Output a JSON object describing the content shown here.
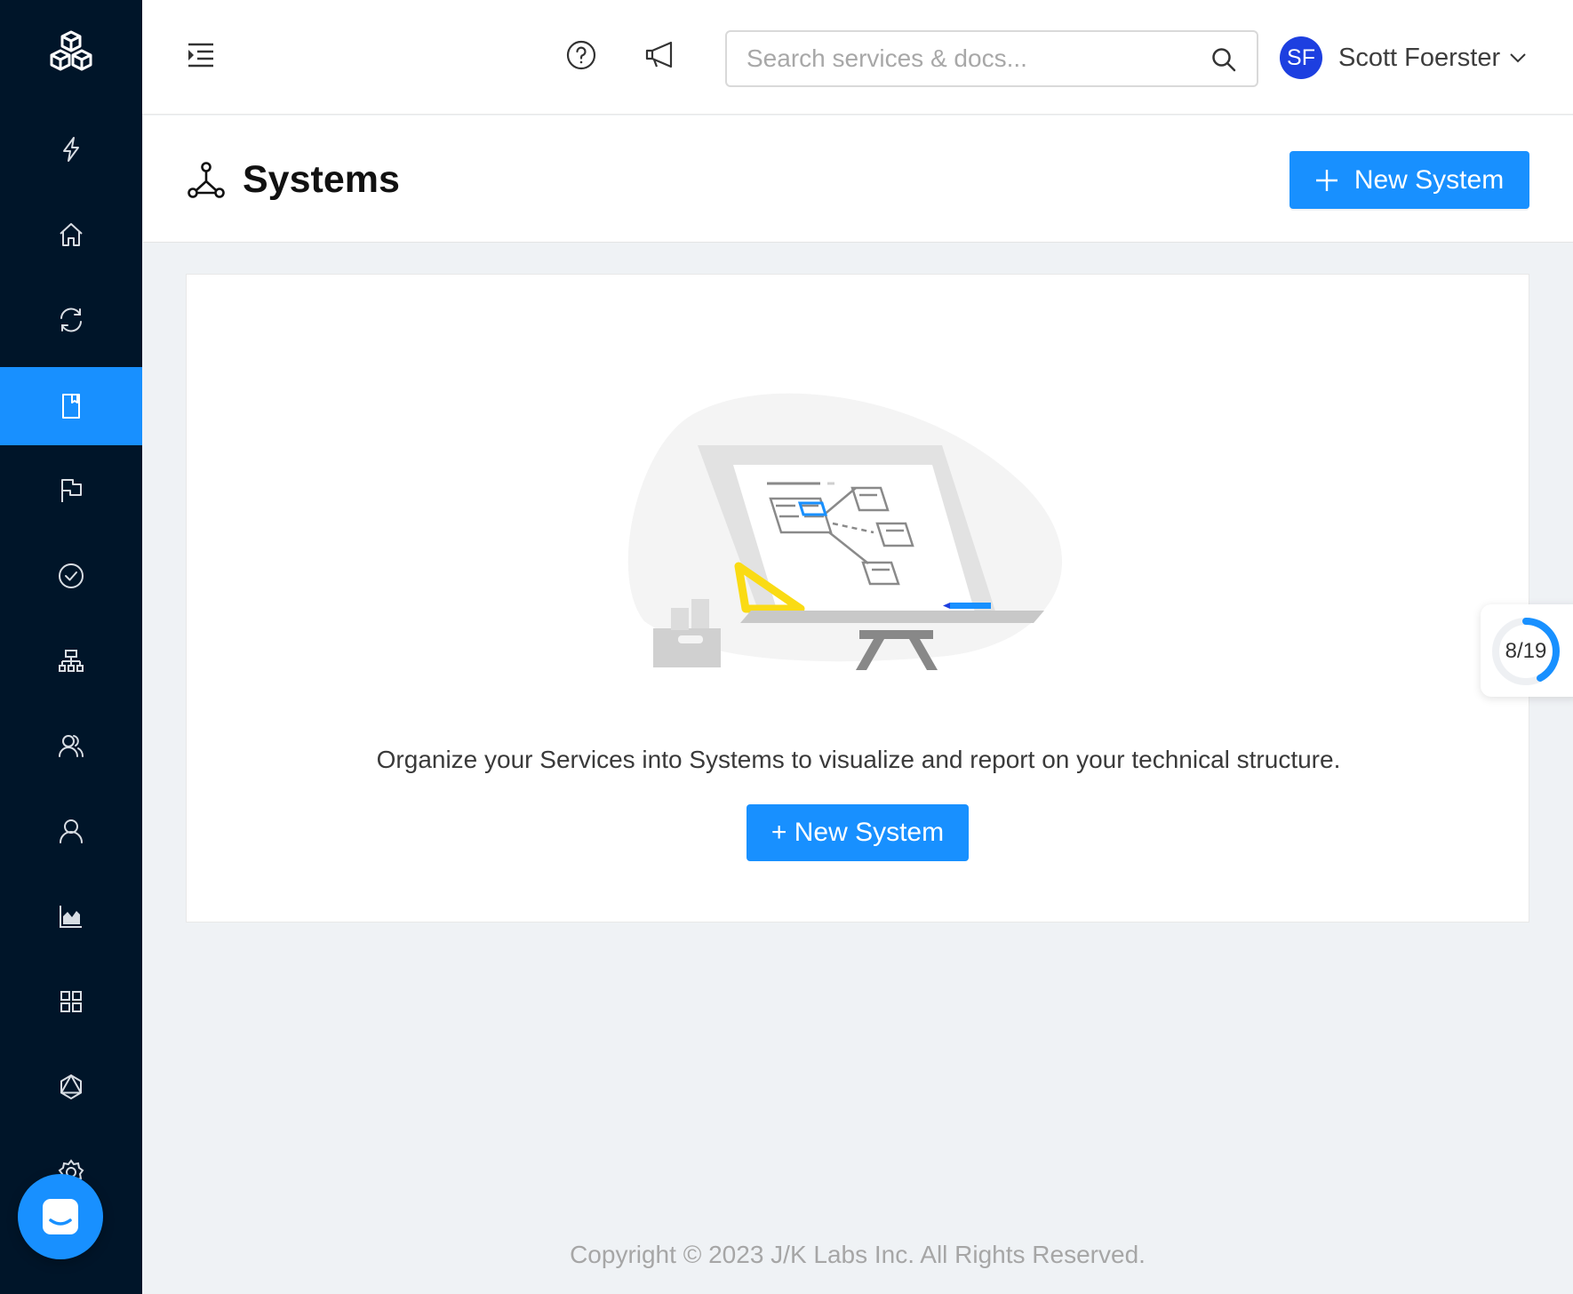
{
  "sidebar": {
    "logo": "cubes-logo-icon",
    "items": [
      {
        "icon": "lightning-icon",
        "active": false
      },
      {
        "icon": "home-icon",
        "active": false
      },
      {
        "icon": "sync-icon",
        "active": false
      },
      {
        "icon": "book-icon",
        "active": true
      },
      {
        "icon": "flag-icon",
        "active": false
      },
      {
        "icon": "check-circle-icon",
        "active": false
      },
      {
        "icon": "hierarchy-icon",
        "active": false
      },
      {
        "icon": "team-icon",
        "active": false
      },
      {
        "icon": "user-icon",
        "active": false
      },
      {
        "icon": "area-chart-icon",
        "active": false
      },
      {
        "icon": "apps-icon",
        "active": false
      },
      {
        "icon": "graphql-icon",
        "active": false
      },
      {
        "icon": "gear-icon",
        "active": false
      }
    ],
    "chat_icon": "chat-icon"
  },
  "header": {
    "search_placeholder": "Search services & docs...",
    "user": {
      "initials": "SF",
      "name": "Scott Foerster"
    }
  },
  "page": {
    "title": "Systems",
    "new_button_label": "New System"
  },
  "empty_state": {
    "message": "Organize your Services into Systems to visualize and report on your technical structure.",
    "button_label": "+ New System"
  },
  "progress": {
    "label": "8/19",
    "done": 8,
    "total": 19
  },
  "footer": {
    "text": "Copyright © 2023 J/K Labs Inc. All Rights Reserved."
  },
  "colors": {
    "sidebar": "#001529",
    "primary": "#1890ff",
    "avatar": "#1d3fe0",
    "accent_yellow": "#fadb14"
  }
}
